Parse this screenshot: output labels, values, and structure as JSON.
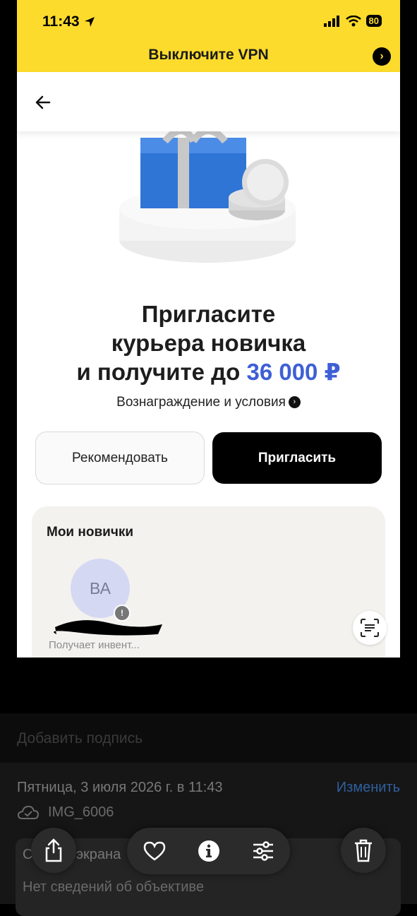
{
  "status_bar": {
    "time": "11:43",
    "battery": "80"
  },
  "banner": {
    "text": "Выключите VPN",
    "arrow_glyph": "›",
    "bg_color": "#fcdb2c"
  },
  "hero": {
    "line1": "Пригласите",
    "line2": "курьера новичка",
    "line3_prefix": "и получите до ",
    "amount": "36 000 ₽",
    "amount_color": "#3e5fd6",
    "terms_link": "Вознаграждение и условия",
    "terms_glyph": "›"
  },
  "buttons": {
    "recommend": "Рекомендовать",
    "invite": "Пригласить"
  },
  "rookies": {
    "title": "Мои новички",
    "items": [
      {
        "initials": "ВА",
        "badge": "!",
        "status": "Получает инвент..."
      }
    ]
  },
  "photo_info": {
    "caption_placeholder": "Добавить подпись",
    "date": "Пятница, 3 июля 2026 г. в 11:43",
    "edit": "Изменить",
    "filename": "IMG_6006",
    "type": "Снимок экрана",
    "lens": "Нет сведений об объективе"
  },
  "toolbar": {
    "icons": [
      "share-icon",
      "heart-icon",
      "info-icon",
      "adjust-icon",
      "trash-icon"
    ]
  }
}
